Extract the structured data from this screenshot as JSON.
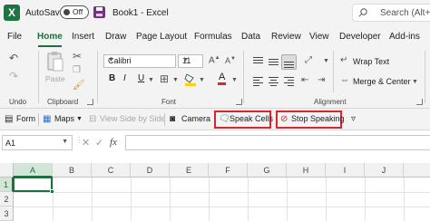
{
  "titlebar": {
    "app_icon": "excel-logo-icon",
    "app_letter": "X",
    "autosave_label": "AutoSave",
    "autosave_state": "Off",
    "save_icon": "save-icon",
    "document_title": "Book1 - Excel",
    "search_placeholder": "Search (Alt+Q)"
  },
  "tabs": [
    "File",
    "Home",
    "Insert",
    "Draw",
    "Page Layout",
    "Formulas",
    "Data",
    "Review",
    "View",
    "Developer",
    "Add-ins"
  ],
  "active_tab": "Home",
  "ribbon": {
    "undo_group_label": "Undo",
    "clipboard": {
      "paste_label": "Paste",
      "group_label": "Clipboard"
    },
    "font": {
      "family": "Calibri",
      "size": "11",
      "bold": "B",
      "italic": "I",
      "underline": "U",
      "group_label": "Font"
    },
    "alignment": {
      "wrap_text": "Wrap Text",
      "merge_center": "Merge & Center",
      "group_label": "Alignment"
    }
  },
  "quick_access": {
    "form": "Form",
    "maps": "Maps",
    "view_side_by_side": "View Side by Side",
    "camera": "Camera",
    "speak_cells": "Speak Cells",
    "stop_speaking": "Stop Speaking",
    "customize": "▿"
  },
  "formula_bar": {
    "name_box": "A1",
    "cancel_icon": "✕",
    "enter_icon": "✓",
    "fx_label": "fx",
    "formula_value": ""
  },
  "sheet": {
    "columns": [
      "A",
      "B",
      "C",
      "D",
      "E",
      "F",
      "G",
      "H",
      "I",
      "J"
    ],
    "rows": [
      "1",
      "2",
      "3"
    ],
    "active_cell": "A1"
  },
  "colors": {
    "accent": "#1f6e3b",
    "highlight_border": "#d9262e",
    "excel_green": "#1f7244",
    "save_purple": "#7a2e88"
  }
}
